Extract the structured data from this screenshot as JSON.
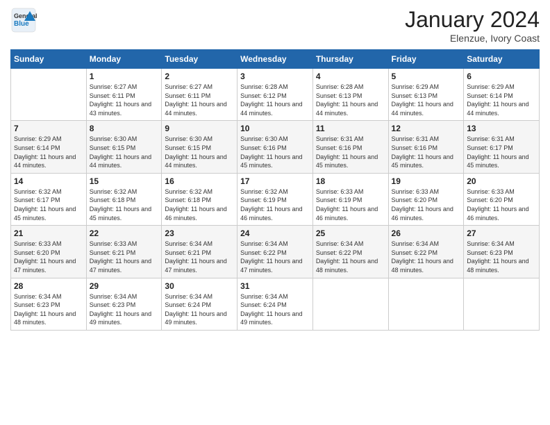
{
  "logo": {
    "general": "General",
    "blue": "Blue"
  },
  "header": {
    "month": "January 2024",
    "location": "Elenzue, Ivory Coast"
  },
  "weekdays": [
    "Sunday",
    "Monday",
    "Tuesday",
    "Wednesday",
    "Thursday",
    "Friday",
    "Saturday"
  ],
  "weeks": [
    [
      {
        "day": "",
        "sunrise": "",
        "sunset": "",
        "daylight": ""
      },
      {
        "day": "1",
        "sunrise": "Sunrise: 6:27 AM",
        "sunset": "Sunset: 6:11 PM",
        "daylight": "Daylight: 11 hours and 43 minutes."
      },
      {
        "day": "2",
        "sunrise": "Sunrise: 6:27 AM",
        "sunset": "Sunset: 6:11 PM",
        "daylight": "Daylight: 11 hours and 44 minutes."
      },
      {
        "day": "3",
        "sunrise": "Sunrise: 6:28 AM",
        "sunset": "Sunset: 6:12 PM",
        "daylight": "Daylight: 11 hours and 44 minutes."
      },
      {
        "day": "4",
        "sunrise": "Sunrise: 6:28 AM",
        "sunset": "Sunset: 6:13 PM",
        "daylight": "Daylight: 11 hours and 44 minutes."
      },
      {
        "day": "5",
        "sunrise": "Sunrise: 6:29 AM",
        "sunset": "Sunset: 6:13 PM",
        "daylight": "Daylight: 11 hours and 44 minutes."
      },
      {
        "day": "6",
        "sunrise": "Sunrise: 6:29 AM",
        "sunset": "Sunset: 6:14 PM",
        "daylight": "Daylight: 11 hours and 44 minutes."
      }
    ],
    [
      {
        "day": "7",
        "sunrise": "Sunrise: 6:29 AM",
        "sunset": "Sunset: 6:14 PM",
        "daylight": "Daylight: 11 hours and 44 minutes."
      },
      {
        "day": "8",
        "sunrise": "Sunrise: 6:30 AM",
        "sunset": "Sunset: 6:15 PM",
        "daylight": "Daylight: 11 hours and 44 minutes."
      },
      {
        "day": "9",
        "sunrise": "Sunrise: 6:30 AM",
        "sunset": "Sunset: 6:15 PM",
        "daylight": "Daylight: 11 hours and 44 minutes."
      },
      {
        "day": "10",
        "sunrise": "Sunrise: 6:30 AM",
        "sunset": "Sunset: 6:16 PM",
        "daylight": "Daylight: 11 hours and 45 minutes."
      },
      {
        "day": "11",
        "sunrise": "Sunrise: 6:31 AM",
        "sunset": "Sunset: 6:16 PM",
        "daylight": "Daylight: 11 hours and 45 minutes."
      },
      {
        "day": "12",
        "sunrise": "Sunrise: 6:31 AM",
        "sunset": "Sunset: 6:16 PM",
        "daylight": "Daylight: 11 hours and 45 minutes."
      },
      {
        "day": "13",
        "sunrise": "Sunrise: 6:31 AM",
        "sunset": "Sunset: 6:17 PM",
        "daylight": "Daylight: 11 hours and 45 minutes."
      }
    ],
    [
      {
        "day": "14",
        "sunrise": "Sunrise: 6:32 AM",
        "sunset": "Sunset: 6:17 PM",
        "daylight": "Daylight: 11 hours and 45 minutes."
      },
      {
        "day": "15",
        "sunrise": "Sunrise: 6:32 AM",
        "sunset": "Sunset: 6:18 PM",
        "daylight": "Daylight: 11 hours and 45 minutes."
      },
      {
        "day": "16",
        "sunrise": "Sunrise: 6:32 AM",
        "sunset": "Sunset: 6:18 PM",
        "daylight": "Daylight: 11 hours and 46 minutes."
      },
      {
        "day": "17",
        "sunrise": "Sunrise: 6:32 AM",
        "sunset": "Sunset: 6:19 PM",
        "daylight": "Daylight: 11 hours and 46 minutes."
      },
      {
        "day": "18",
        "sunrise": "Sunrise: 6:33 AM",
        "sunset": "Sunset: 6:19 PM",
        "daylight": "Daylight: 11 hours and 46 minutes."
      },
      {
        "day": "19",
        "sunrise": "Sunrise: 6:33 AM",
        "sunset": "Sunset: 6:20 PM",
        "daylight": "Daylight: 11 hours and 46 minutes."
      },
      {
        "day": "20",
        "sunrise": "Sunrise: 6:33 AM",
        "sunset": "Sunset: 6:20 PM",
        "daylight": "Daylight: 11 hours and 46 minutes."
      }
    ],
    [
      {
        "day": "21",
        "sunrise": "Sunrise: 6:33 AM",
        "sunset": "Sunset: 6:20 PM",
        "daylight": "Daylight: 11 hours and 47 minutes."
      },
      {
        "day": "22",
        "sunrise": "Sunrise: 6:33 AM",
        "sunset": "Sunset: 6:21 PM",
        "daylight": "Daylight: 11 hours and 47 minutes."
      },
      {
        "day": "23",
        "sunrise": "Sunrise: 6:34 AM",
        "sunset": "Sunset: 6:21 PM",
        "daylight": "Daylight: 11 hours and 47 minutes."
      },
      {
        "day": "24",
        "sunrise": "Sunrise: 6:34 AM",
        "sunset": "Sunset: 6:22 PM",
        "daylight": "Daylight: 11 hours and 47 minutes."
      },
      {
        "day": "25",
        "sunrise": "Sunrise: 6:34 AM",
        "sunset": "Sunset: 6:22 PM",
        "daylight": "Daylight: 11 hours and 48 minutes."
      },
      {
        "day": "26",
        "sunrise": "Sunrise: 6:34 AM",
        "sunset": "Sunset: 6:22 PM",
        "daylight": "Daylight: 11 hours and 48 minutes."
      },
      {
        "day": "27",
        "sunrise": "Sunrise: 6:34 AM",
        "sunset": "Sunset: 6:23 PM",
        "daylight": "Daylight: 11 hours and 48 minutes."
      }
    ],
    [
      {
        "day": "28",
        "sunrise": "Sunrise: 6:34 AM",
        "sunset": "Sunset: 6:23 PM",
        "daylight": "Daylight: 11 hours and 48 minutes."
      },
      {
        "day": "29",
        "sunrise": "Sunrise: 6:34 AM",
        "sunset": "Sunset: 6:23 PM",
        "daylight": "Daylight: 11 hours and 49 minutes."
      },
      {
        "day": "30",
        "sunrise": "Sunrise: 6:34 AM",
        "sunset": "Sunset: 6:24 PM",
        "daylight": "Daylight: 11 hours and 49 minutes."
      },
      {
        "day": "31",
        "sunrise": "Sunrise: 6:34 AM",
        "sunset": "Sunset: 6:24 PM",
        "daylight": "Daylight: 11 hours and 49 minutes."
      },
      {
        "day": "",
        "sunrise": "",
        "sunset": "",
        "daylight": ""
      },
      {
        "day": "",
        "sunrise": "",
        "sunset": "",
        "daylight": ""
      },
      {
        "day": "",
        "sunrise": "",
        "sunset": "",
        "daylight": ""
      }
    ]
  ]
}
